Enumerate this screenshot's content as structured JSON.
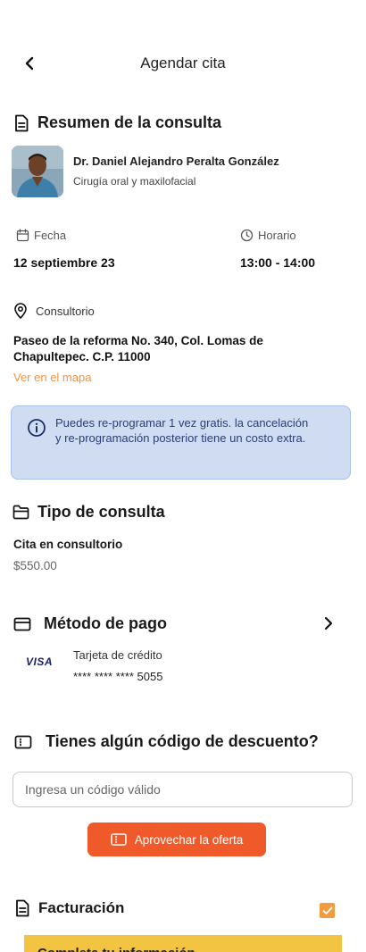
{
  "header": {
    "title": "Agendar cita"
  },
  "summary": {
    "title": "Resumen de la consulta",
    "doctor_name": "Dr. Daniel Alejandro Peralta González",
    "doctor_specialty": "Cirugía oral y maxilofacial",
    "date_label": "Fecha",
    "date_value": "12 septiembre 23",
    "time_label": "Horario",
    "time_value": "13:00 - 14:00",
    "office_label": "Consultorio",
    "address": "Paseo de la reforma No. 340, Col. Lomas de Chapultepec. C.P. 11000",
    "map_link": "Ver en el mapa"
  },
  "notice": {
    "text": "Puedes re-programar 1 vez gratis. la cancelación y re-programación posterior tiene un costo extra."
  },
  "consult_type": {
    "title": "Tipo de consulta",
    "value": "Cita en consultorio",
    "price": "$550.00"
  },
  "payment": {
    "title": "Método de pago",
    "brand": "VISA",
    "card_type": "Tarjeta de crédito",
    "card_number": "**** **** **** 5055"
  },
  "discount": {
    "title": "Tienes algún código de descuento?",
    "placeholder": "Ingresa un código válido",
    "button_label": "Aprovechar la oferta"
  },
  "billing": {
    "title": "Facturación",
    "checked": true,
    "banner_text": "Completa tu información"
  },
  "colors": {
    "accent": "#f05a2a",
    "link": "#f0944a",
    "info_bg": "#cfdcf1",
    "info_text": "#2a3f78",
    "banner": "#f2c442"
  }
}
